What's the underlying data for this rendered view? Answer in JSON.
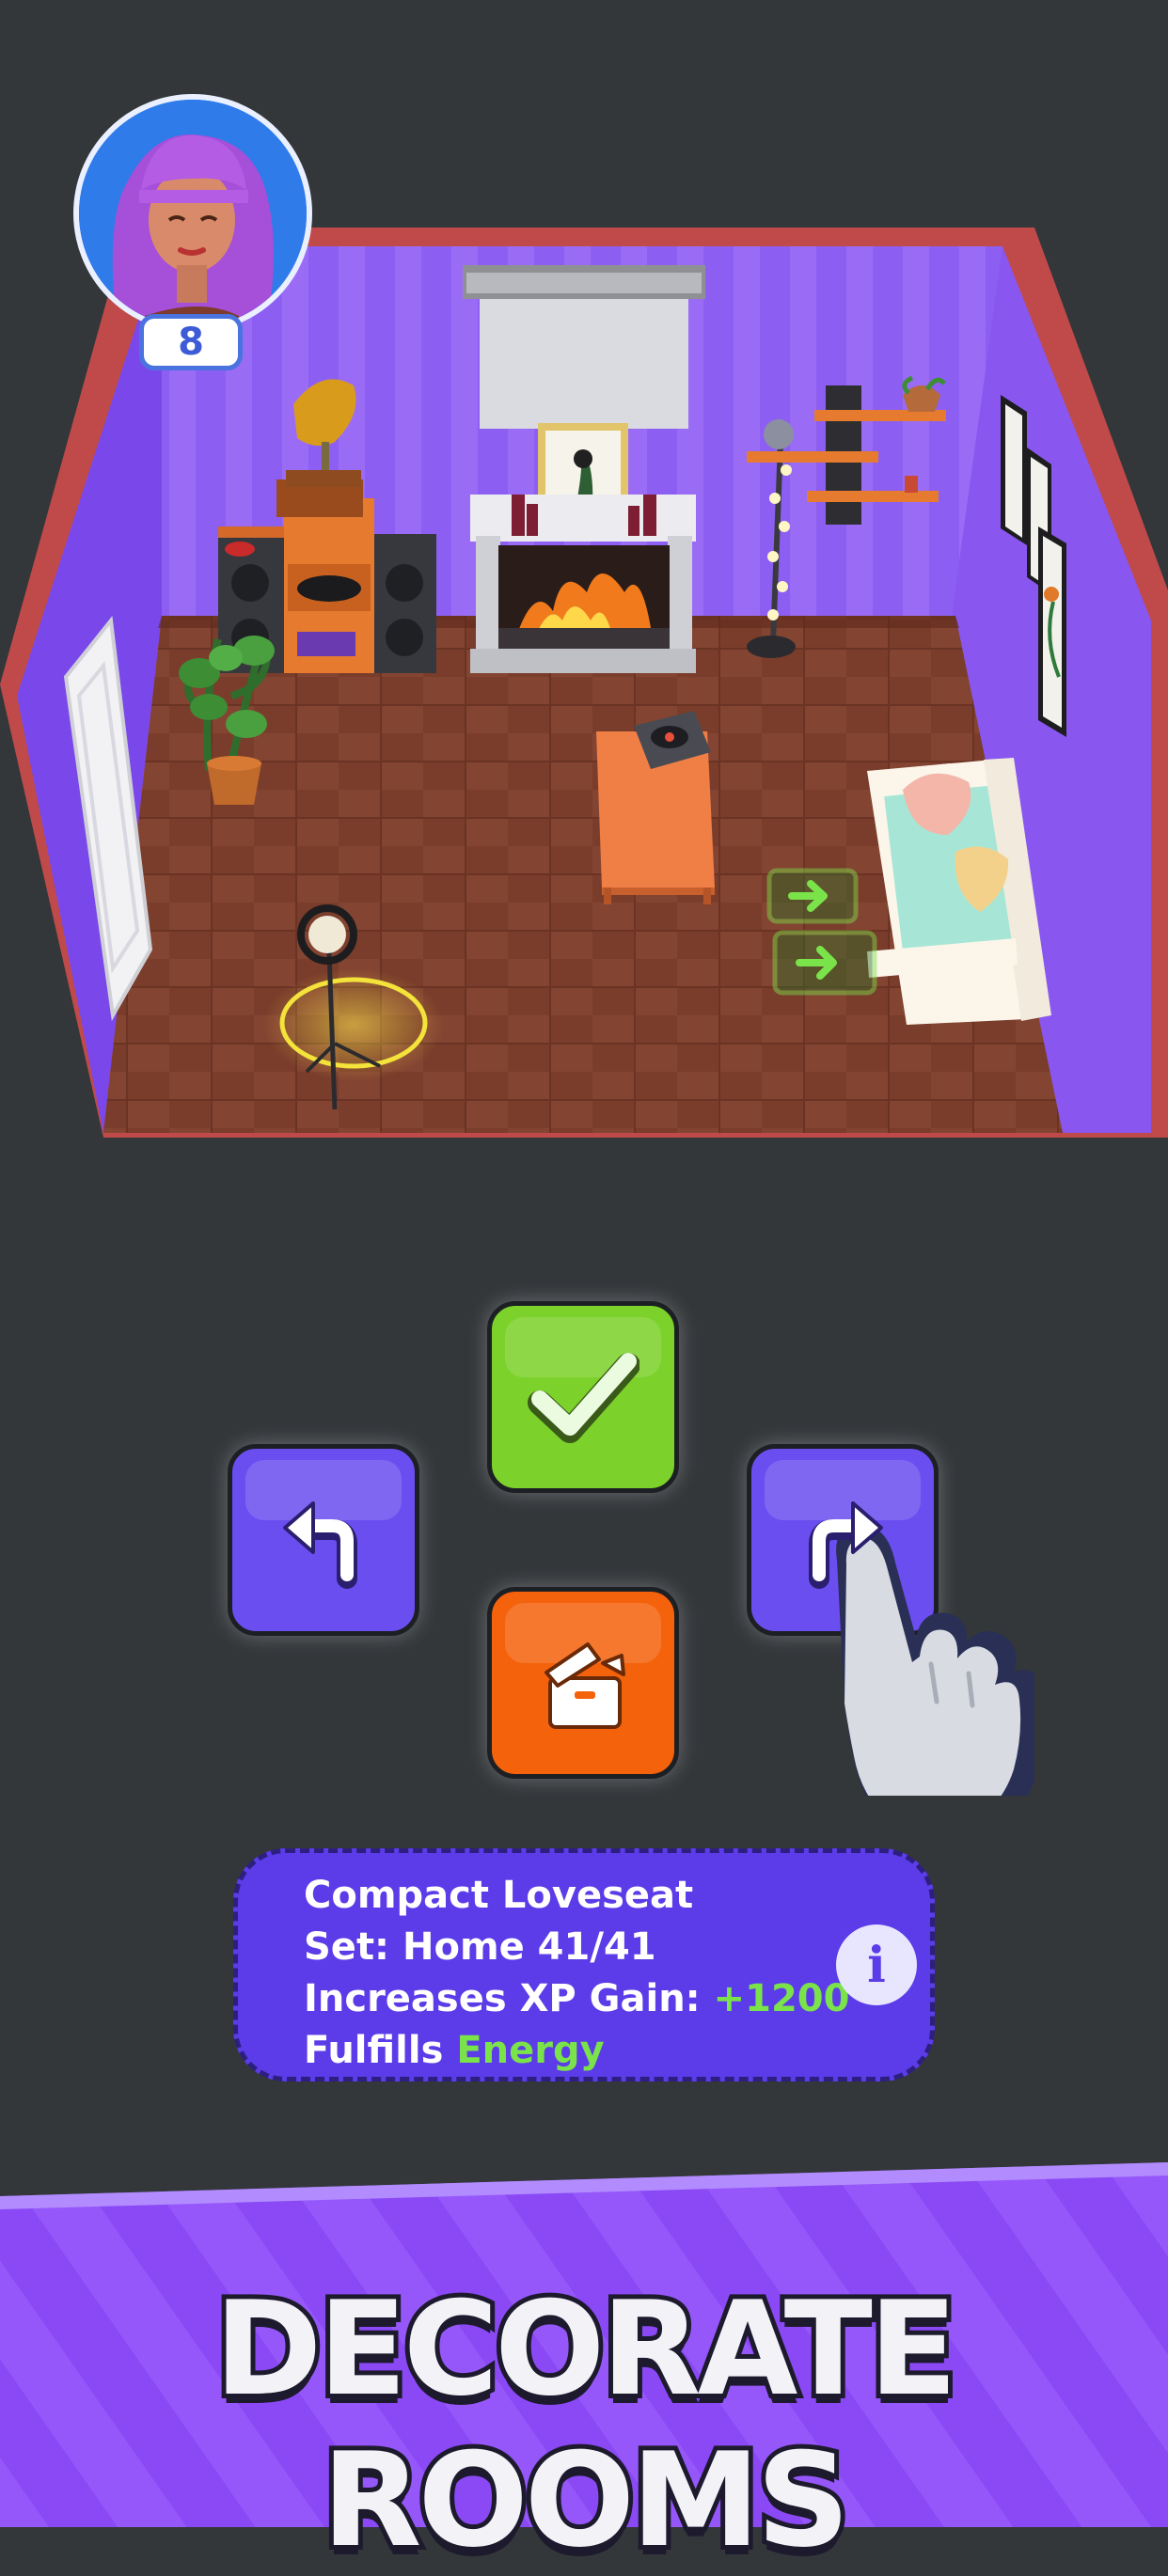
{
  "player": {
    "level": "8"
  },
  "item_panel": {
    "name": "Compact Loveseat",
    "set_line": "Set: Home 41/41",
    "xp_label": "Increases XP Gain: ",
    "xp_value": "+1200",
    "fulfills_label": "Fulfills ",
    "fulfills_value": "Energy",
    "info_glyph": "i"
  },
  "controls": {
    "confirm_icon": "checkmark-icon",
    "rotate_left_icon": "rotate-left-icon",
    "rotate_right_icon": "rotate-right-icon",
    "store_icon": "storage-box-icon"
  },
  "banner": {
    "title": "DECORATE ROOMS"
  },
  "colors": {
    "background": "#33373a",
    "confirm_green": "#7cd22a",
    "rotate_purple": "#6b4ef0",
    "store_orange": "#f4620c",
    "panel_purple": "#5b3ce8",
    "highlight_green": "#7be34a",
    "banner_purple": "#8b49f6"
  }
}
